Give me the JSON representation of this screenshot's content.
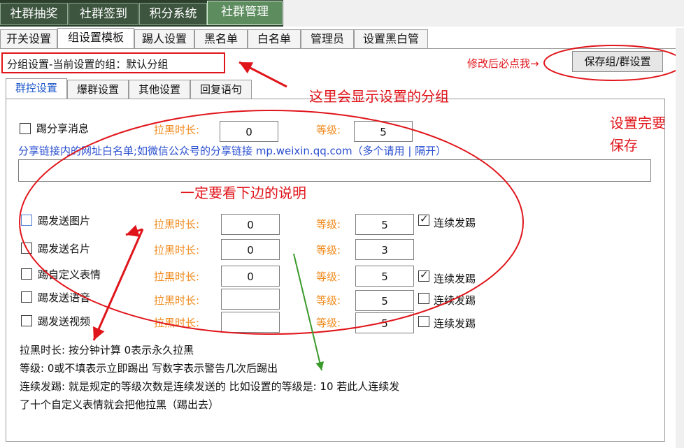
{
  "top_tabs": [
    {
      "label": "社群抽奖"
    },
    {
      "label": "社群签到"
    },
    {
      "label": "积分系统"
    },
    {
      "label": "社群管理"
    }
  ],
  "main_tabs": [
    {
      "label": "开关设置"
    },
    {
      "label": "组设置模板"
    },
    {
      "label": "踢人设置"
    },
    {
      "label": "黑名单"
    },
    {
      "label": "白名单"
    },
    {
      "label": "管理员"
    },
    {
      "label": "设置黑白管"
    }
  ],
  "group_status": "分组设置-当前设置的组：默认分组",
  "save_hint": "修改后必点我→",
  "save_button": "保存组/群设置",
  "inner_tabs": [
    {
      "label": "群控设置"
    },
    {
      "label": "爆群设置"
    },
    {
      "label": "其他设置"
    },
    {
      "label": "回复语句"
    }
  ],
  "share": {
    "label": "踢分享消息",
    "checked": false,
    "ban_label": "拉黑时长:",
    "ban_value": "0",
    "level_label": "等级:",
    "level_value": "5",
    "whitelist_hint": "分享链接内的网址白名单;如微信公众号的分享链接 mp.weixin.qq.com（多个请用 | 隔开）",
    "whitelist_value": ""
  },
  "rules": [
    {
      "label": "踢发送图片",
      "ban_label": "拉黑时长:",
      "ban_value": "0",
      "level_label": "等级:",
      "level_value": "5",
      "continuous_label": "连续发踢",
      "continuous_checked": true,
      "show_continuous": true
    },
    {
      "label": "踢发送名片",
      "ban_label": "拉黑时长:",
      "ban_value": "0",
      "level_label": "等级:",
      "level_value": "3",
      "continuous_label": "",
      "continuous_checked": false,
      "show_continuous": false
    },
    {
      "label": "踢自定义表情",
      "ban_label": "拉黑时长:",
      "ban_value": "0",
      "level_label": "等级:",
      "level_value": "5",
      "continuous_label": "连续发踢",
      "continuous_checked": true,
      "show_continuous": true
    },
    {
      "label": "踢发送语音",
      "ban_label": "拉黑时长:",
      "ban_value": "",
      "level_label": "等级:",
      "level_value": "5",
      "continuous_label": "连续发踢",
      "continuous_checked": false,
      "show_continuous": true
    },
    {
      "label": "踢发送视频",
      "ban_label": "拉黑时长:",
      "ban_value": "",
      "level_label": "等级:",
      "level_value": "5",
      "continuous_label": "连续发踢",
      "continuous_checked": false,
      "show_continuous": true
    }
  ],
  "notes": [
    "拉黑时长: 按分钟计算  0表示永久拉黑",
    "等级: 0或不填表示立即踢出 写数字表示警告几次后踢出",
    "连续发踢: 就是规定的等级次数是连续发送的 比如设置的等级是: 10 若此人连续发",
    "了十个自定义表情就会把他拉黑（踢出去）"
  ],
  "annotations": {
    "group_display": "这里会显示设置的分组",
    "save_reminder_1": "设置完要",
    "save_reminder_2": "保存",
    "read_below": "一定要看下边的说明"
  },
  "colors": {
    "annotation_red": "#e0151b",
    "field_label_orange": "#f08a1c",
    "link_blue": "#2a4fd0",
    "arrow_green": "#3a9a2a",
    "top_tab_dark": "#2b3e2c"
  }
}
